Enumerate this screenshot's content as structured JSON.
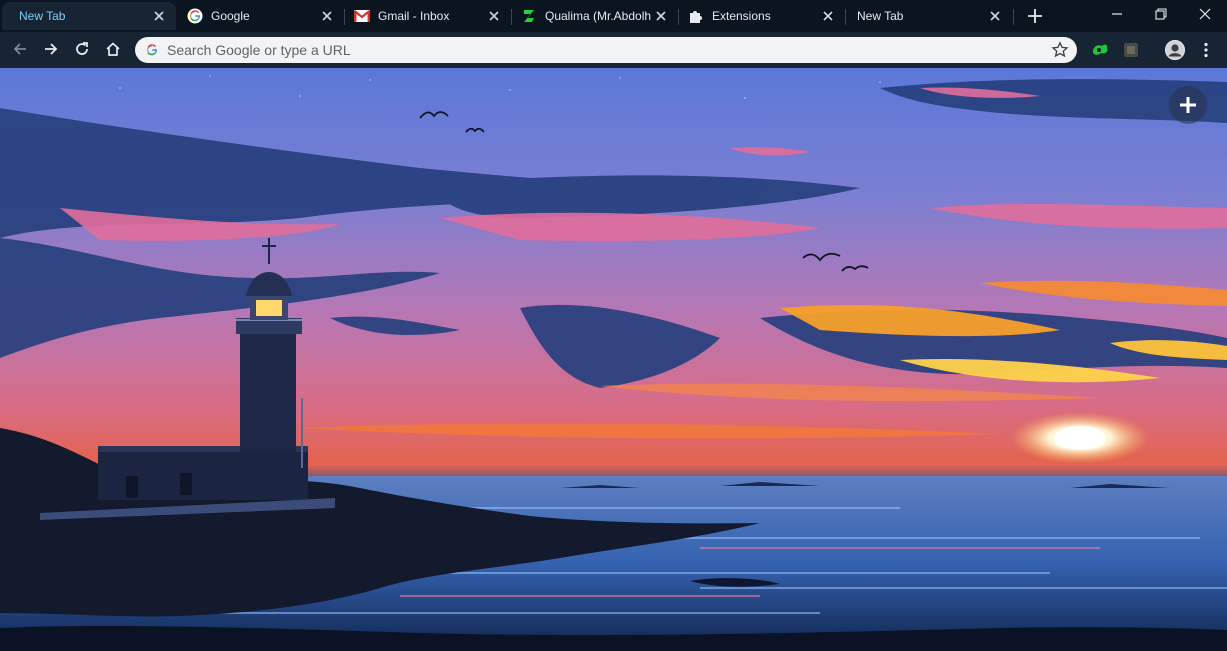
{
  "tabs": [
    {
      "title": "New Tab",
      "favicon": "none",
      "active": true
    },
    {
      "title": "Google",
      "favicon": "google-g-icon",
      "active": false
    },
    {
      "title": "Gmail - Inbox",
      "favicon": "gmail-icon",
      "active": false
    },
    {
      "title": "Qualima (Mr.Abdolh",
      "favicon": "qualima-icon",
      "active": false
    },
    {
      "title": "Extensions",
      "favicon": "puzzle-icon",
      "active": false
    },
    {
      "title": "New Tab",
      "favicon": "none",
      "active": false
    }
  ],
  "omnibox": {
    "placeholder": "Search Google or type a URL",
    "value": ""
  },
  "colors": {
    "tabstrip": "#0a1520",
    "toolbar": "#162433",
    "active_tab_text": "#7fd0ff",
    "omnibox_bg": "#f1f3f4"
  },
  "icons": {
    "back": "arrow-left-icon",
    "forward": "arrow-right-icon",
    "reload": "reload-icon",
    "home": "home-icon",
    "bookmark": "star-icon",
    "extension_1": "green-extension-icon",
    "extension_2": "dark-extension-icon",
    "profile": "avatar",
    "menu": "kebab-menu-icon",
    "new_tab": "plus-icon",
    "add_shortcut": "plus-icon"
  }
}
